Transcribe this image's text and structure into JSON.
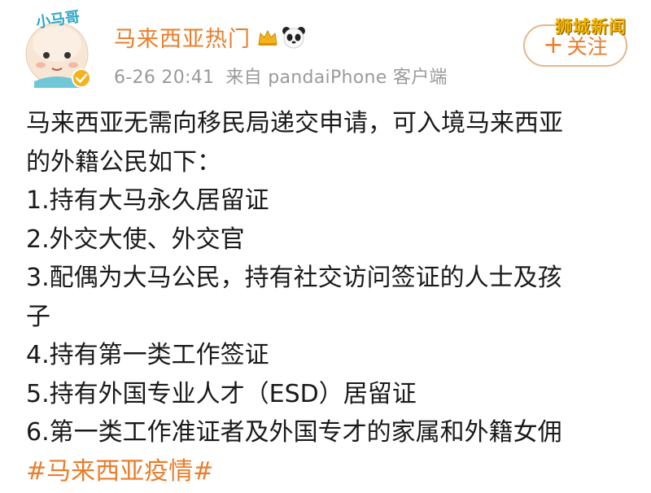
{
  "post": {
    "author": "马来西亚热门",
    "avatar_caption": "小马哥",
    "timestamp": "6-26 20:41",
    "source": "来自 pandaiPhone 客户端",
    "follow_label": "关注",
    "follow_plus": "+",
    "lines": [
      "马来西亚无需向移民局递交申请，可入境马来西亚",
      "的外籍公民如下：",
      "1.持有大马永久居留证",
      "2.外交大使、外交官",
      "3.配偶为大马公民，持有社交访问签证的人士及孩",
      "子",
      "4.持有第一类工作签证",
      "5.持有外国专业人才（ESD）居留证",
      "6.第一类工作准证者及外国专才的家属和外籍女佣"
    ],
    "hashtag": "#马来西亚疫情#"
  },
  "watermark": "狮城新闻",
  "colors": {
    "accent": "#ea7d2a",
    "meta": "#9a9a9a",
    "watermark": "#f2b400",
    "verified": "#f5b21b"
  }
}
